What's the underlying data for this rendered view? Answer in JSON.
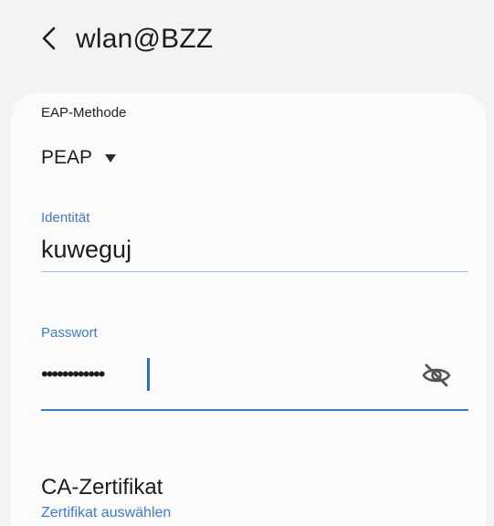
{
  "header": {
    "title": "wlan@BZZ",
    "back_icon": "chevron-left-icon"
  },
  "eap": {
    "label": "EAP-Methode",
    "value": "PEAP",
    "dropdown_icon": "triangle-down-icon"
  },
  "identity": {
    "label": "Identität",
    "value": "kuweguj"
  },
  "password": {
    "label": "Passwort",
    "masked_value": "••••••••••••",
    "toggle_icon": "eye-off-icon"
  },
  "ca_certificate": {
    "title": "CA-Zertifikat",
    "subtitle": "Zertifikat auswählen"
  },
  "colors": {
    "accent": "#3d7bc8",
    "background": "#f3f3f3",
    "card": "#fbfbfb",
    "text": "#1c1c1c"
  }
}
